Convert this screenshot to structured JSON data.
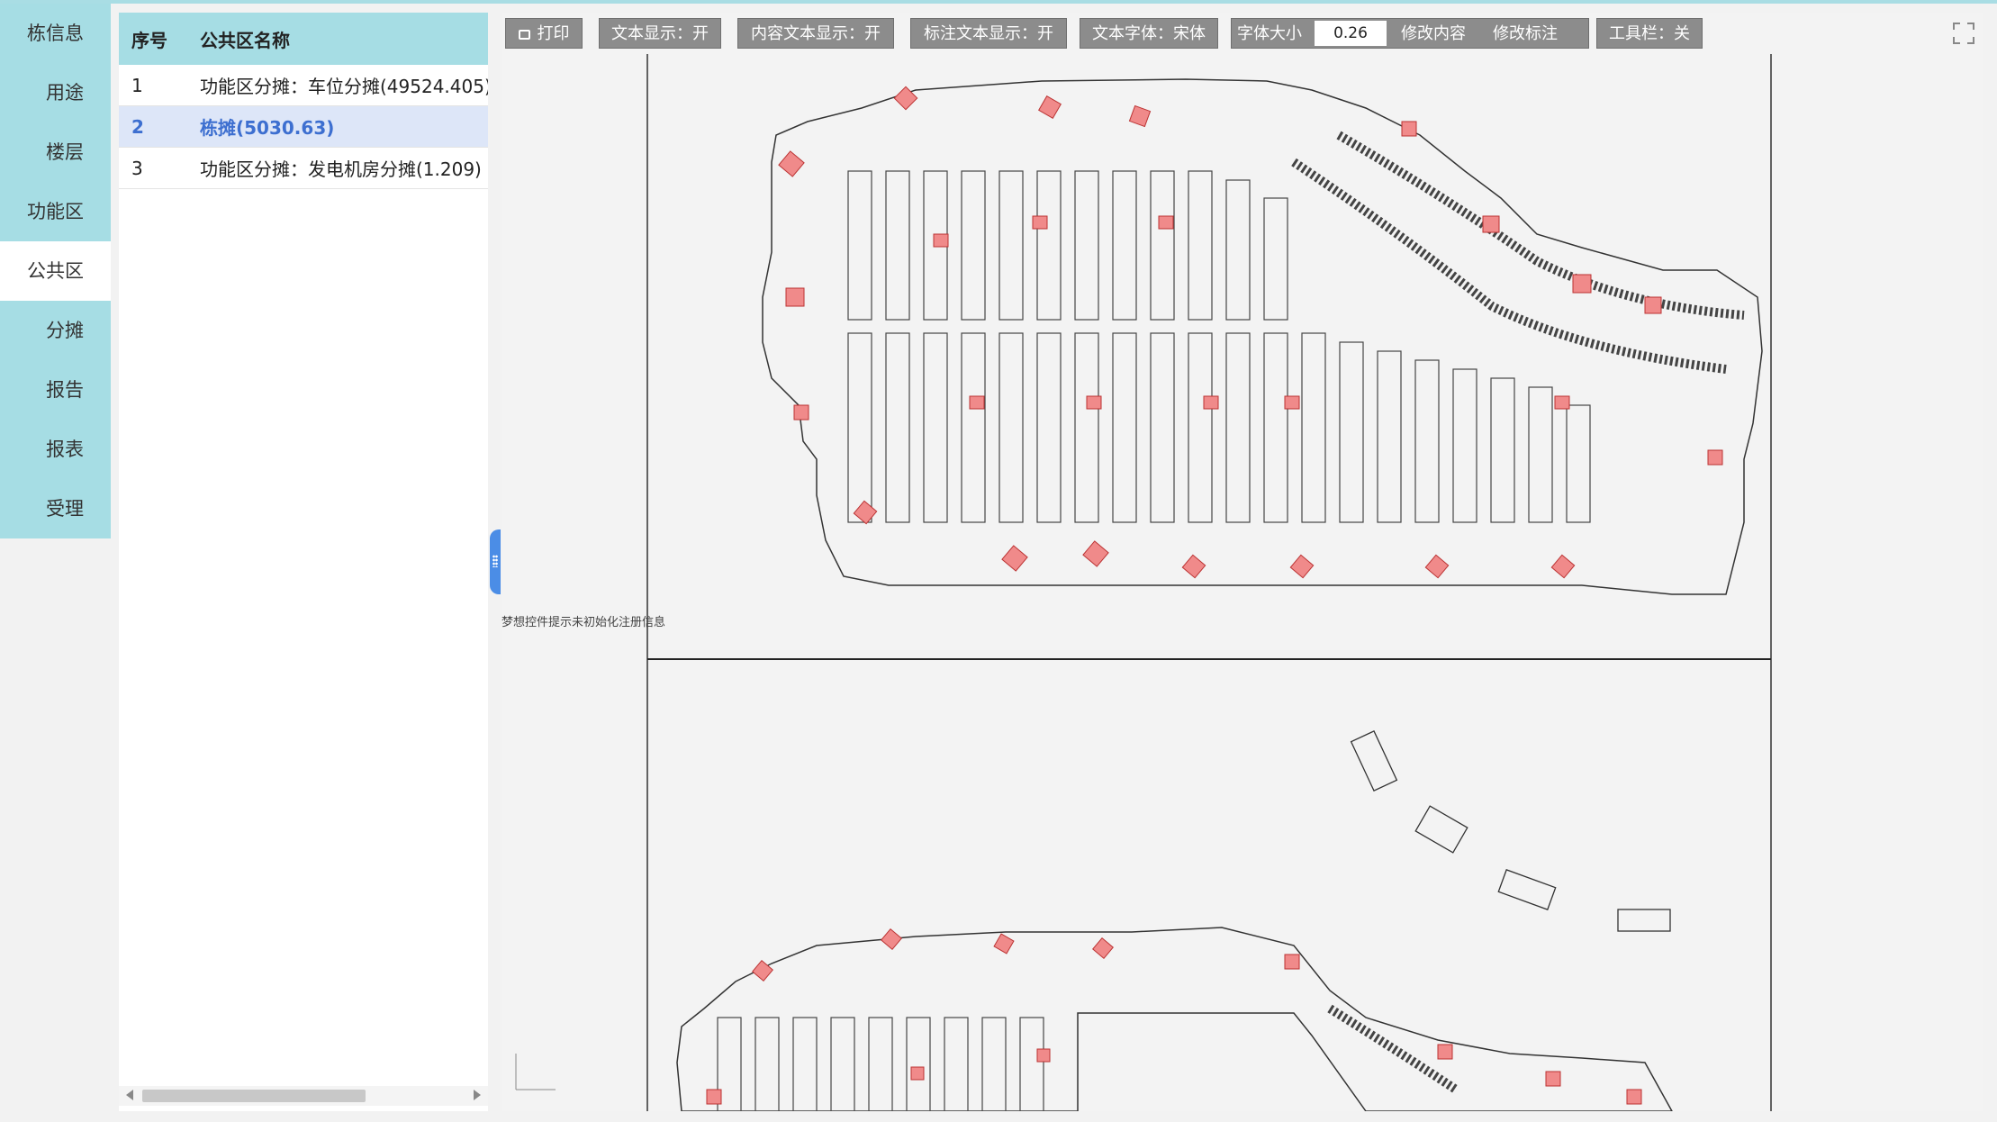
{
  "nav": {
    "items": [
      {
        "label": "栋信息"
      },
      {
        "label": "用途"
      },
      {
        "label": "楼层"
      },
      {
        "label": "功能区"
      },
      {
        "label": "公共区"
      },
      {
        "label": "分摊"
      },
      {
        "label": "报告"
      },
      {
        "label": "报表"
      },
      {
        "label": "受理"
      }
    ],
    "active": "公共区"
  },
  "list": {
    "headers": {
      "idx": "序号",
      "name": "公共区名称"
    },
    "rows": [
      {
        "idx": "1",
        "name": "功能区分摊：车位分摊(49524.405)"
      },
      {
        "idx": "2",
        "name": "栋摊(5030.63)"
      },
      {
        "idx": "3",
        "name": "功能区分摊：发电机房分摊(1.209)"
      }
    ],
    "selected_index": 1
  },
  "toolbar": {
    "print": "打印",
    "text_display": "文本显示：开",
    "content_text_display": "内容文本显示：开",
    "label_text_display": "标注文本显示：开",
    "text_font": "文本字体：宋体",
    "font_size_label": "字体大小",
    "font_size_value": "0.26",
    "edit_content": "修改内容",
    "edit_label": "修改标注",
    "toolbar_toggle": "工具栏：关"
  },
  "viewer": {
    "hint_text": "梦想控件提示未初始化注册信息"
  },
  "colors": {
    "nav_bg": "#a6dde4",
    "header_bg": "#a6dde4",
    "selected_row_bg": "#dde6f8",
    "selected_row_text": "#3d6fd0",
    "toolbar_btn": "#8c8c8c",
    "highlight_fill": "#f08a8a",
    "splitter": "#4b8de6"
  },
  "icons": {
    "print": "printer-icon",
    "fullscreen": "fullscreen-icon",
    "splitter": "drag-handle-icon"
  }
}
